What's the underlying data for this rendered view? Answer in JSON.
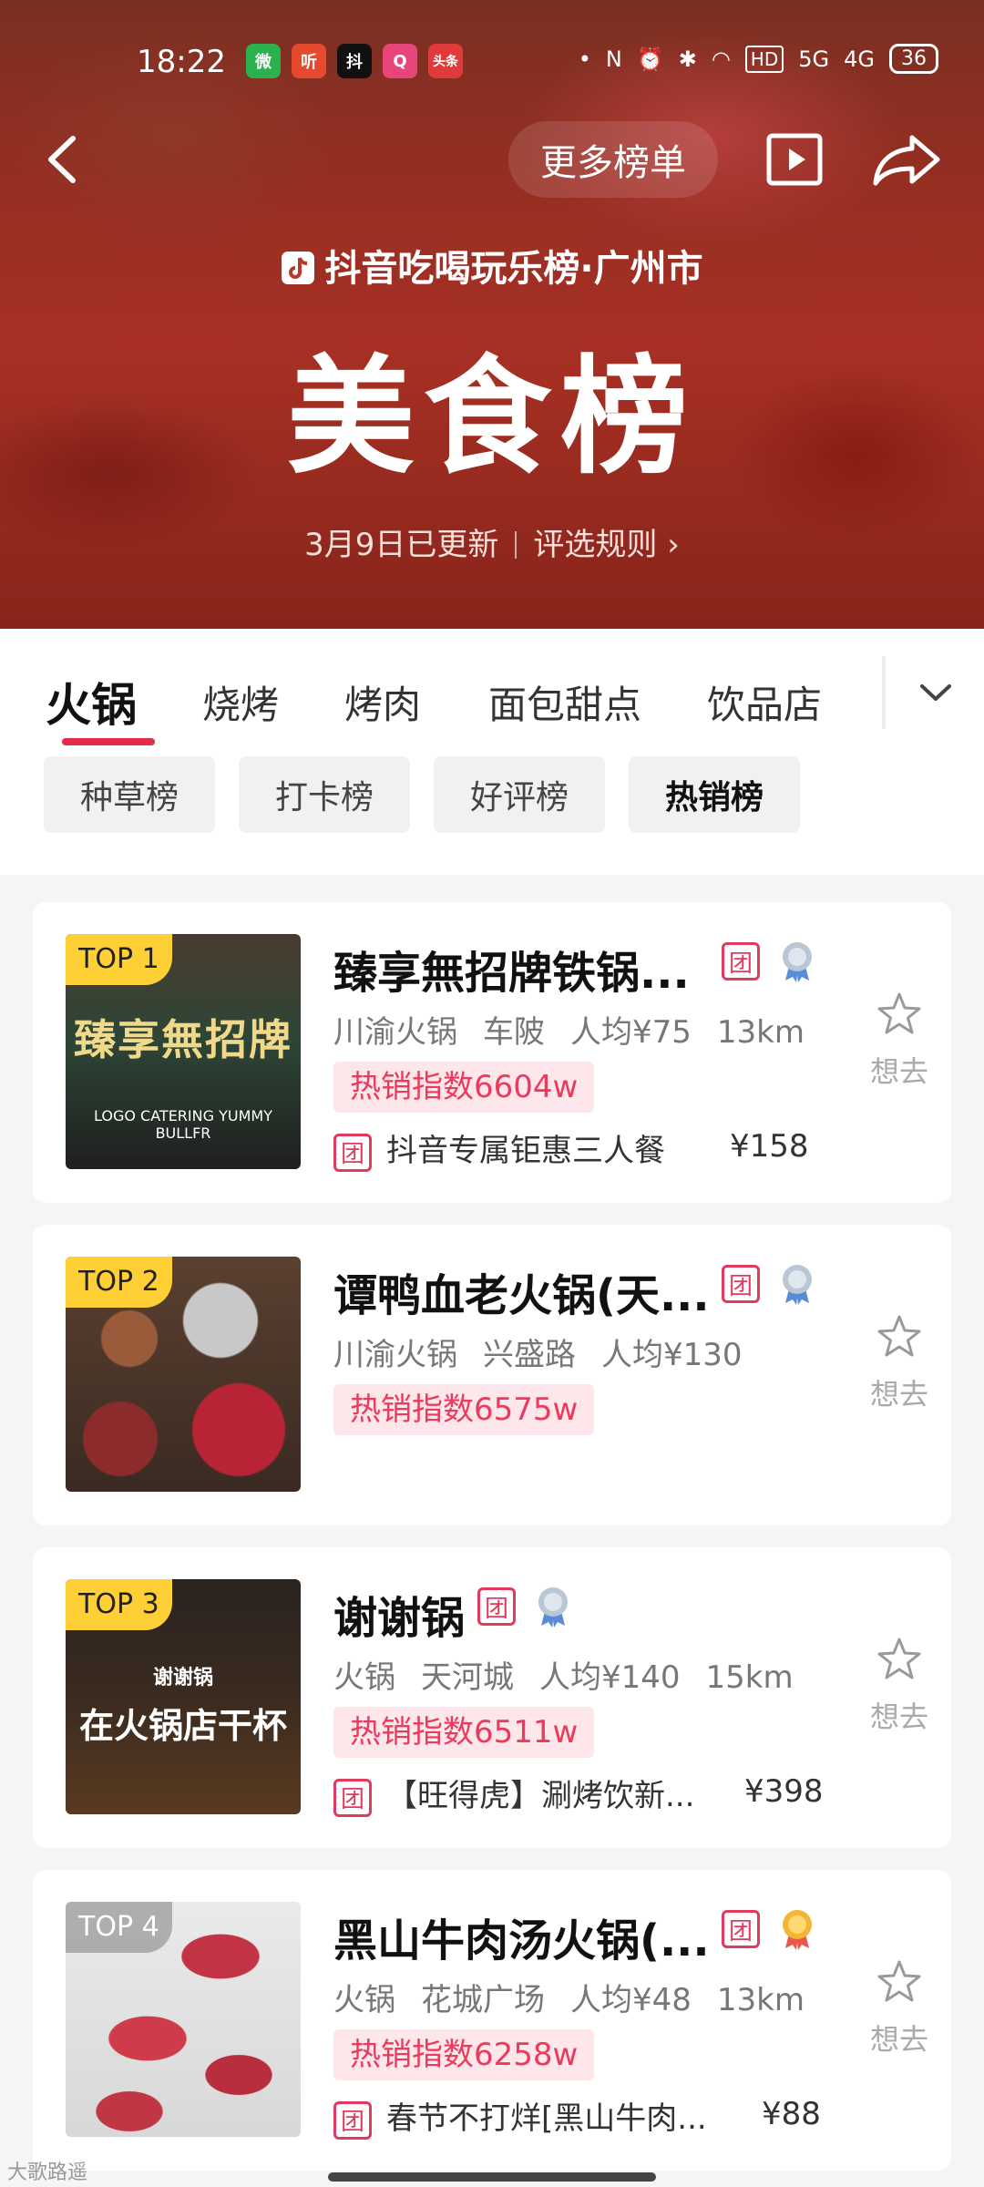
{
  "status_bar": {
    "time": "18:22",
    "apps": [
      "微",
      "听",
      "抖",
      "Q",
      "头条"
    ],
    "network_label": "HD",
    "sig1": "5G",
    "sig2": "4G",
    "battery": "36"
  },
  "header": {
    "more_lists": "更多榜单",
    "brand": "抖音吃喝玩乐榜·广州市",
    "title": "美食榜",
    "updated": "3月9日已更新",
    "rules": "评选规则 ›"
  },
  "tabs": [
    "火锅",
    "烧烤",
    "烤肉",
    "面包甜点",
    "饮品店"
  ],
  "active_tab": "火锅",
  "subtabs": [
    "种草榜",
    "打卡榜",
    "好评榜",
    "热销榜"
  ],
  "active_subtab": "热销榜",
  "want_label": "想去",
  "tuan_label": "团",
  "items": [
    {
      "rank": "TOP 1",
      "thumb_text": "臻享無招牌",
      "thumb_sub": "LOGO CATERING  YUMMY BULLFR",
      "name": "臻享無招牌铁锅...",
      "cuisine": "川渝火锅",
      "area": "车陂",
      "avg": "人均¥75",
      "distance": "13km",
      "hot": "热销指数6604w",
      "deal": "抖音专属钜惠三人餐",
      "price": "¥158",
      "medal": "silver"
    },
    {
      "rank": "TOP 2",
      "thumb_text": "",
      "thumb_sub": "",
      "name": "谭鸭血老火锅(天...",
      "cuisine": "川渝火锅",
      "area": "兴盛路",
      "avg": "人均¥130",
      "distance": "",
      "hot": "热销指数6575w",
      "deal": "",
      "price": "",
      "medal": "silver"
    },
    {
      "rank": "TOP 3",
      "thumb_text": "在火锅店干杯",
      "thumb_sub": "谢谢锅",
      "name": "谢谢锅",
      "cuisine": "火锅",
      "area": "天河城",
      "avg": "人均¥140",
      "distance": "15km",
      "hot": "热销指数6511w",
      "deal": "【旺得虎】涮烤饮新...",
      "price": "¥398",
      "medal": "silver"
    },
    {
      "rank": "TOP 4",
      "thumb_text": "",
      "thumb_sub": "",
      "name": "黑山牛肉汤火锅(...",
      "cuisine": "火锅",
      "area": "花城广场",
      "avg": "人均¥48",
      "distance": "13km",
      "hot": "热销指数6258w",
      "deal": "春节不打烊[黑山牛肉...",
      "price": "¥88",
      "medal": "gold"
    }
  ],
  "watermark": "大歌路遥",
  "colors": {
    "accent": "#e22c4a",
    "hot_bg": "#fde7ea",
    "rank_bg": "#ffcf36"
  }
}
